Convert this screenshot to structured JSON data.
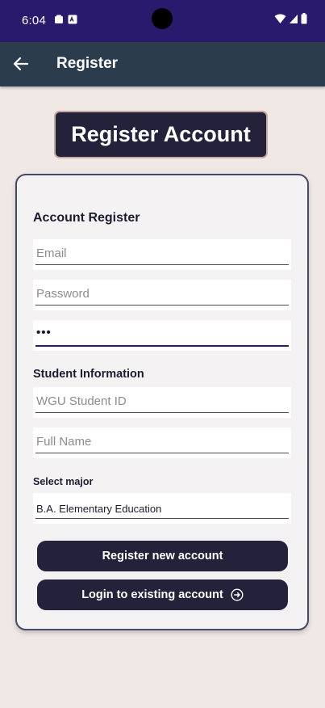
{
  "status_bar": {
    "time": "6:04",
    "icons": [
      "notification-icon",
      "sim-icon",
      "wifi-icon",
      "signal-icon",
      "battery-icon"
    ]
  },
  "app_bar": {
    "back_icon": "arrow-left-icon",
    "title": "Register"
  },
  "header": {
    "title": "Register Account"
  },
  "form": {
    "account_section_title": "Account Register",
    "email": {
      "placeholder": "Email",
      "value": ""
    },
    "password": {
      "placeholder": "Password",
      "value": ""
    },
    "confirm_password": {
      "value": "•••"
    },
    "student_section_title": "Student Information",
    "student_id": {
      "placeholder": "WGU Student ID",
      "value": ""
    },
    "full_name": {
      "placeholder": "Full Name",
      "value": ""
    },
    "major_label": "Select major",
    "major_selected": "B.A. Elementary Education"
  },
  "buttons": {
    "register_label": "Register new account",
    "login_label": "Login to existing account",
    "login_icon": "arrow-right-circle-icon"
  },
  "colors": {
    "status_bar": "#2a1a6e",
    "app_bar": "#2b3c4c",
    "background": "#efe8e4",
    "button": "#24213a",
    "card_border": "#464a66"
  }
}
